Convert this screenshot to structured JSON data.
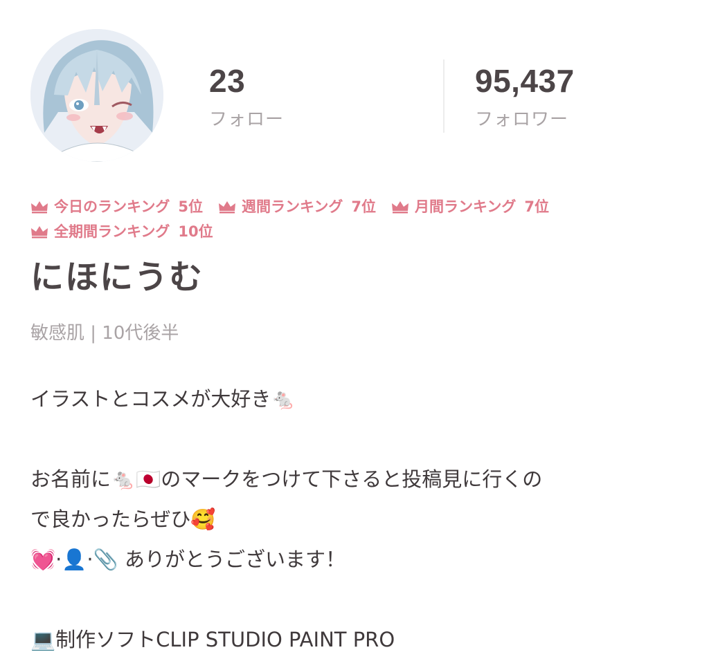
{
  "profile": {
    "follow_count": "23",
    "follow_label": "フォロー",
    "follower_count": "95,437",
    "follower_label": "フォロワー",
    "rankings": [
      {
        "label": "今日のランキング",
        "position": "5位"
      },
      {
        "label": "週間ランキング",
        "position": "7位"
      },
      {
        "label": "月間ランキング",
        "position": "7位"
      },
      {
        "label": "全期間ランキング",
        "position": "10位"
      }
    ],
    "name": "にほにうむ",
    "meta": "敏感肌 | 10代後半",
    "bio": {
      "line1": "イラストとコスメが大好き🐁",
      "line2": "お名前に🐁🇯🇵のマークをつけて下さると投稿見に行くの",
      "line3": "で良かったらぜひ🥰",
      "line4": "💓·👤·📎 ありがとうございます！",
      "line5": "💻制作ソフトCLIP STUDIO PAINT PRO"
    }
  },
  "colors": {
    "accent_pink": "#e07a8a",
    "text_dark": "#4c4547",
    "text_muted": "#a9a3a5",
    "divider": "#ececec"
  },
  "icons": {
    "crown": "crown-icon",
    "avatar": "avatar-illustration"
  }
}
